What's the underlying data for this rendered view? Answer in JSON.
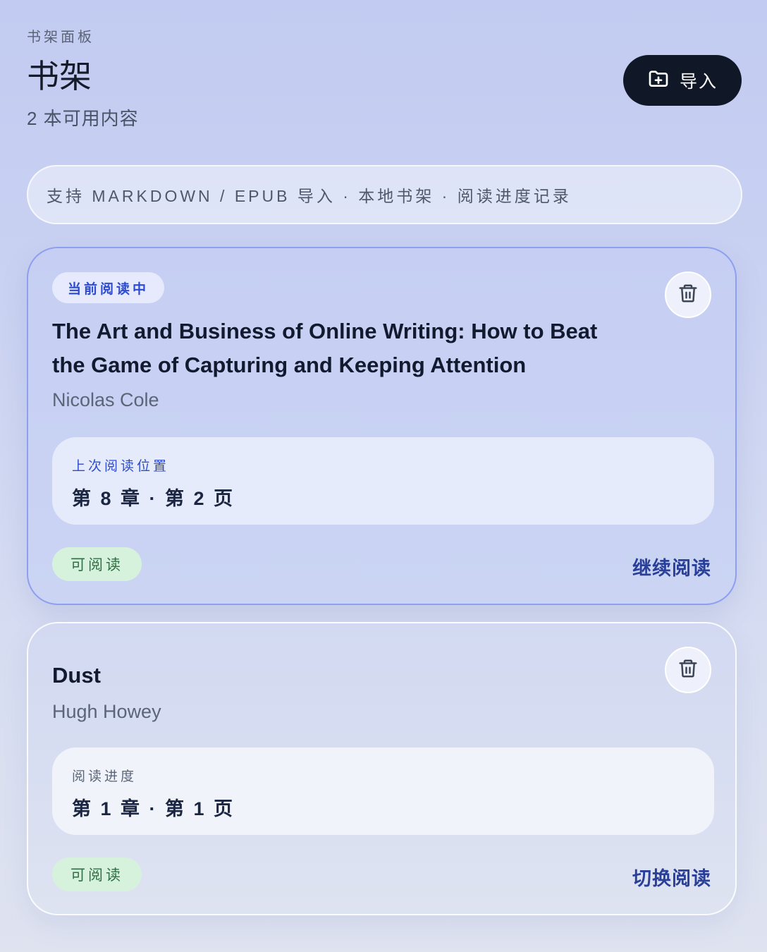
{
  "header": {
    "eyebrow": "书架面板",
    "title": "书架",
    "subtitle": "2 本可用内容",
    "import_label": "导入"
  },
  "feature_bar": {
    "text": "支持 MARKDOWN / EPUB 导入 · 本地书架 · 阅读进度记录"
  },
  "books": [
    {
      "tag": "当前阅读中",
      "title": "The Art and Business of Online Writing: How to Beat the Game of Capturing and Keeping Attention",
      "author": "Nicolas Cole",
      "progress_label": "上次阅读位置",
      "progress_value": "第 8 章 · 第 2 页",
      "status": "可阅读",
      "action": "继续阅读"
    },
    {
      "title": "Dust",
      "author": "Hugh Howey",
      "progress_label": "阅读进度",
      "progress_value": "第 1 章 · 第 1 页",
      "status": "可阅读",
      "action": "切换阅读"
    }
  ],
  "colors": {
    "accent": "#2d4bd2",
    "button_dark": "#101828",
    "status_bg": "#d6f2dd",
    "status_text": "#2f6f43"
  },
  "icons": {
    "import": "folder-plus-icon",
    "delete": "trash-icon"
  }
}
